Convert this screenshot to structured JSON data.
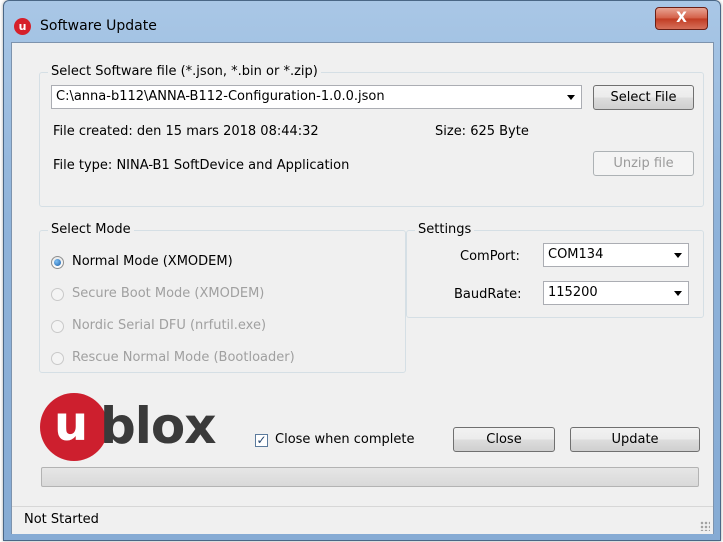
{
  "window": {
    "title": "Software Update",
    "icon_letter": "u",
    "close_glyph": "X"
  },
  "file_group": {
    "legend": "Select Software file (*.json, *.bin or *.zip)",
    "path_value": "C:\\anna-b112\\ANNA-B112-Configuration-1.0.0.json",
    "select_file_label": "Select File",
    "created_text": "File created: den 15 mars 2018 08:44:32",
    "size_text": "Size: 625 Byte",
    "type_text": "File type: NINA-B1 SoftDevice and Application",
    "unzip_label": "Unzip file"
  },
  "mode_group": {
    "legend": "Select Mode",
    "options": [
      {
        "label": "Normal Mode (XMODEM)",
        "selected": true,
        "enabled": true
      },
      {
        "label": "Secure Boot Mode (XMODEM)",
        "selected": false,
        "enabled": false
      },
      {
        "label": "Nordic Serial DFU (nrfutil.exe)",
        "selected": false,
        "enabled": false
      },
      {
        "label": "Rescue Normal Mode (Bootloader)",
        "selected": false,
        "enabled": false
      }
    ]
  },
  "settings_group": {
    "legend": "Settings",
    "comport_label": "ComPort:",
    "comport_value": "COM134",
    "baudrate_label": "BaudRate:",
    "baudrate_value": "115200"
  },
  "logo": {
    "u": "u",
    "text": "blox",
    "brand_color": "#cd1f2e"
  },
  "actions": {
    "close_when_complete_label": "Close when complete",
    "close_when_complete_checked": true,
    "check_glyph": "✓",
    "close_label": "Close",
    "update_label": "Update"
  },
  "progress": {
    "value": 0
  },
  "status": {
    "text": "Not Started"
  }
}
